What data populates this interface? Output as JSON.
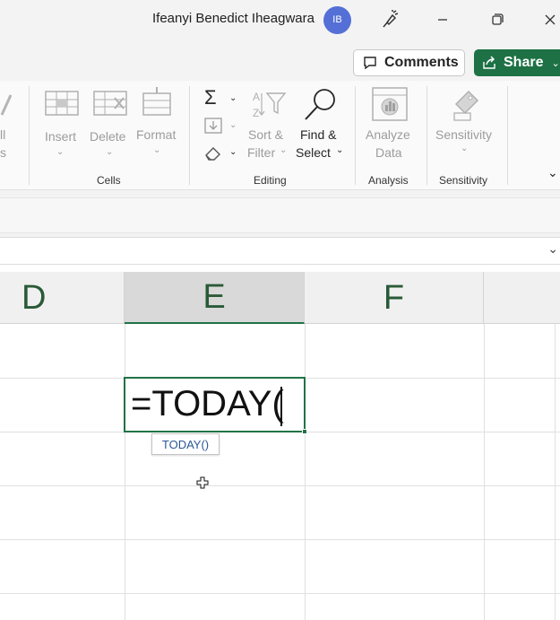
{
  "titlebar": {
    "user_name": "Ifeanyi Benedict Iheagwara",
    "avatar_initials": "IB",
    "avatar_color": "#5470d6"
  },
  "actions": {
    "comments_label": "Comments",
    "share_label": "Share",
    "share_color": "#1e7145"
  },
  "ribbon": {
    "partial_left": {
      "line1": "ll",
      "line2": "s"
    },
    "cells": {
      "insert_label": "Insert",
      "delete_label": "Delete",
      "format_label": "Format",
      "group_label": "Cells"
    },
    "editing": {
      "sort_filter_line1": "Sort &",
      "sort_filter_line2": "Filter",
      "find_select_line1": "Find &",
      "find_select_line2": "Select",
      "group_label": "Editing"
    },
    "analysis": {
      "analyze_line1": "Analyze",
      "analyze_line2": "Data",
      "group_label": "Analysis"
    },
    "sensitivity": {
      "button_label": "Sensitivity",
      "group_label": "Sensitivity"
    }
  },
  "sheet": {
    "columns": [
      "D",
      "E",
      "F"
    ],
    "selected_column": "E",
    "active_cell_text": "=TODAY(",
    "autocomplete_tooltip": "TODAY()",
    "accent": "#217346"
  }
}
